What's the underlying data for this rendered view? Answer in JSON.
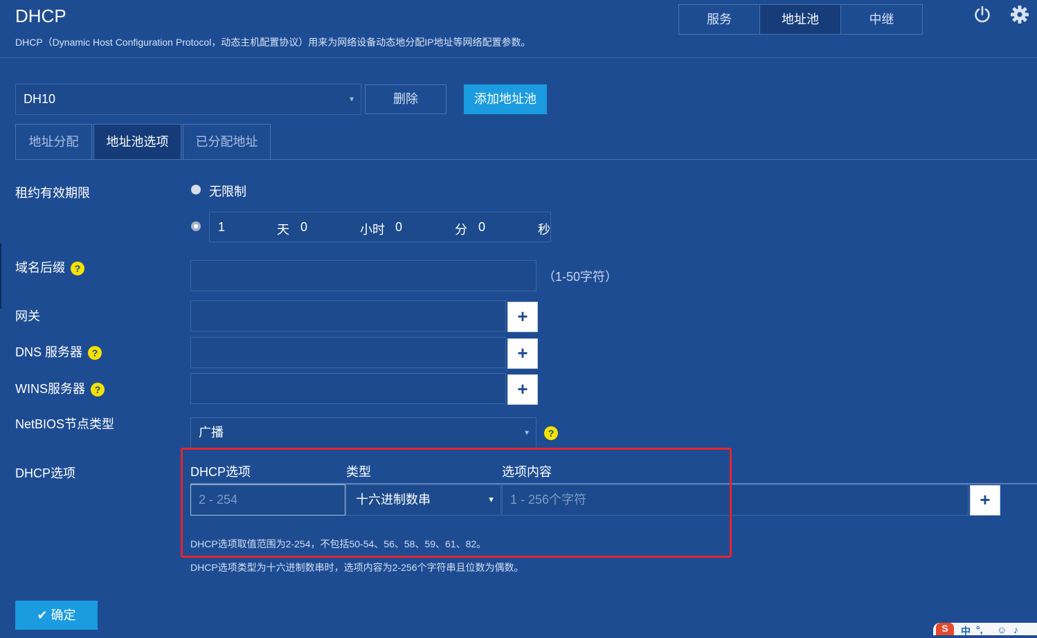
{
  "header": {
    "title": "DHCP",
    "description": "DHCP（Dynamic Host Configuration Protocol，动态主机配置协议）用来为网络设备动态地分配IP地址等网络配置参数。",
    "segments": [
      {
        "label": "服务",
        "active": false
      },
      {
        "label": "地址池",
        "active": true
      },
      {
        "label": "中继",
        "active": false
      }
    ],
    "icons": [
      "power-icon",
      "gear-icon"
    ]
  },
  "pool": {
    "selected": "DH10",
    "delete_label": "删除",
    "add_label": "添加地址池"
  },
  "tabs": [
    {
      "label": "地址分配",
      "active": false
    },
    {
      "label": "地址池选项",
      "active": true
    },
    {
      "label": "已分配地址",
      "active": false
    }
  ],
  "lease": {
    "label": "租约有效期限",
    "unlimited_label": "无限制",
    "unlimited_selected": false,
    "custom_selected": true,
    "days": "1",
    "days_unit": "天",
    "hours": "0",
    "hours_unit": "小时",
    "minutes": "0",
    "minutes_unit": "分",
    "seconds": "0",
    "seconds_unit": "秒"
  },
  "domain": {
    "label": "域名后缀",
    "value": "",
    "hint": "（1-50字符）"
  },
  "gateway": {
    "label": "网关",
    "value": ""
  },
  "dns": {
    "label": "DNS 服务器",
    "value": ""
  },
  "wins": {
    "label": "WINS服务器",
    "value": ""
  },
  "netbios": {
    "label": "NetBIOS节点类型",
    "selected": "广播"
  },
  "dhcp_options": {
    "label": "DHCP选项",
    "col_option": "DHCP选项",
    "col_type": "类型",
    "col_content": "选项内容",
    "option_placeholder": "2 - 254",
    "type_selected": "十六进制数串",
    "content_placeholder": "1 - 256个字符",
    "note1": "DHCP选项取值范围为2-254，不包括50-54、56、58、59、61、82。",
    "note2": "DHCP选项类型为十六进制数串时，选项内容为2-256个字符串且位数为偶数。"
  },
  "confirm_label": "确定",
  "tray": {
    "label1": "中",
    "label2": "°,"
  },
  "colors": {
    "background": "#1e4c93",
    "accent": "#1b9be0",
    "highlight_border": "#e8232a",
    "help": "#f5e200"
  }
}
